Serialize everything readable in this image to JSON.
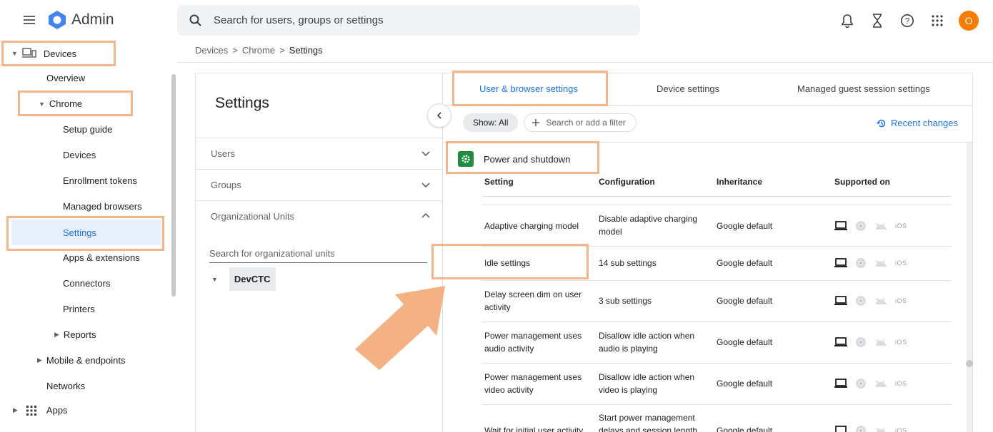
{
  "app": {
    "title": "Admin"
  },
  "search": {
    "placeholder": "Search for users, groups or settings"
  },
  "top_icons": [
    "bell-icon",
    "hourglass-icon",
    "help-icon",
    "apps-grid-icon"
  ],
  "avatar_initial": "O",
  "colors": {
    "accent": "#1a73e8",
    "highlight": "#f5b48a",
    "avatar": "#f57c00",
    "section_icon": "#1e8e3e"
  },
  "breadcrumb": {
    "items": [
      "Devices",
      "Chrome"
    ],
    "current": "Settings",
    "separator": ">"
  },
  "sidebar": {
    "devices": "Devices",
    "overview": "Overview",
    "chrome": "Chrome",
    "chrome_items": [
      "Setup guide",
      "Devices",
      "Enrollment tokens",
      "Managed browsers",
      "Settings",
      "Apps & extensions",
      "Connectors",
      "Printers"
    ],
    "reports": "Reports",
    "mobile": "Mobile & endpoints",
    "networks": "Networks",
    "apps": "Apps"
  },
  "settings_panel": {
    "title": "Settings",
    "accordions": [
      "Users",
      "Groups",
      "Organizational Units"
    ],
    "ou_search_placeholder": "Search for organizational units",
    "ou_root": "DevCTC"
  },
  "tabs": [
    "User & browser settings",
    "Device settings",
    "Managed guest session settings"
  ],
  "filters": {
    "show": "Show: All",
    "add": "Search or add a filter"
  },
  "recent_changes": "Recent changes",
  "section": {
    "title": "Power and shutdown"
  },
  "table": {
    "headers": [
      "Setting",
      "Configuration",
      "Inheritance",
      "Supported on"
    ],
    "rows": [
      {
        "setting": "Adaptive charging model",
        "config": "Disable adaptive charging model",
        "inheritance": "Google default"
      },
      {
        "setting": "Idle settings",
        "config": "14 sub settings",
        "inheritance": "Google default"
      },
      {
        "setting": "Delay screen dim on user activity",
        "config": "3 sub settings",
        "inheritance": "Google default"
      },
      {
        "setting": "Power management uses audio activity",
        "config": "Disallow idle action when audio is playing",
        "inheritance": "Google default"
      },
      {
        "setting": "Power management uses video activity",
        "config": "Disallow idle action when video is playing",
        "inheritance": "Google default"
      },
      {
        "setting": "Wait for initial user activity",
        "config": "Start power management delays and session length",
        "inheritance": "Google default"
      }
    ],
    "supported_platforms": [
      "laptop-icon",
      "chrome-icon",
      "android-icon",
      "ios-label"
    ],
    "ios_text": "iOS"
  }
}
